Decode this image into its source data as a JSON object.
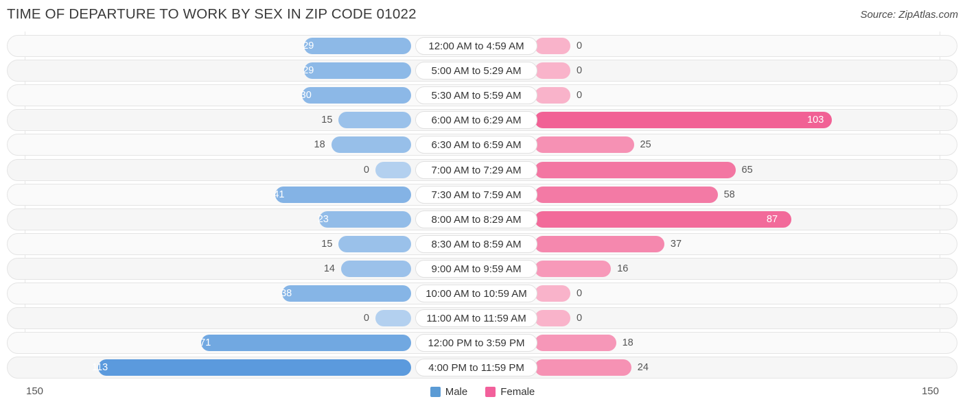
{
  "header": {
    "title": "TIME OF DEPARTURE TO WORK BY SEX IN ZIP CODE 01022",
    "source": "Source: ZipAtlas.com"
  },
  "legend": {
    "items": [
      {
        "label": "Male",
        "color": "#5B9BD5"
      },
      {
        "label": "Female",
        "color": "#F2609B"
      }
    ]
  },
  "axis": {
    "left_max": "150",
    "right_max": "150"
  },
  "chart_data": {
    "type": "bar",
    "subtype": "diverging-bar",
    "title": "TIME OF DEPARTURE TO WORK BY SEX IN ZIP CODE 01022",
    "xlabel": "",
    "ylabel": "",
    "xlim": [
      0,
      150
    ],
    "grid": false,
    "legend_position": "bottom-center",
    "categories": [
      "12:00 AM to 4:59 AM",
      "5:00 AM to 5:29 AM",
      "5:30 AM to 5:59 AM",
      "6:00 AM to 6:29 AM",
      "6:30 AM to 6:59 AM",
      "7:00 AM to 7:29 AM",
      "7:30 AM to 7:59 AM",
      "8:00 AM to 8:29 AM",
      "8:30 AM to 8:59 AM",
      "9:00 AM to 9:59 AM",
      "10:00 AM to 10:59 AM",
      "11:00 AM to 11:59 AM",
      "12:00 PM to 3:59 PM",
      "4:00 PM to 11:59 PM"
    ],
    "series": [
      {
        "name": "Male",
        "direction": "left",
        "color": "#5B9BD5",
        "values": [
          29,
          29,
          30,
          15,
          18,
          0,
          41,
          23,
          15,
          14,
          38,
          0,
          71,
          113
        ]
      },
      {
        "name": "Female",
        "direction": "right",
        "color": "#F2609B",
        "values": [
          0,
          0,
          0,
          103,
          25,
          65,
          58,
          87,
          37,
          16,
          0,
          0,
          18,
          24
        ]
      }
    ]
  }
}
